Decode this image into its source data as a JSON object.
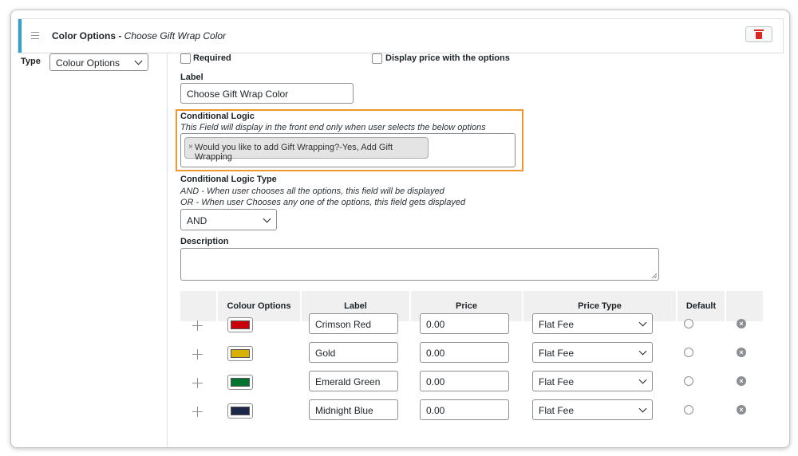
{
  "header": {
    "title": "Color Options -",
    "subtitle": "Choose Gift Wrap Color",
    "menu_icon": "hamburger-icon",
    "delete_icon": "trash-icon",
    "accent_color": "#2ea2cc",
    "delete_color": "#e0241b"
  },
  "type_field": {
    "label": "Type",
    "value": "Colour Options"
  },
  "required": {
    "label": "Required",
    "checked": false
  },
  "display_price": {
    "label": "Display price with the options",
    "checked": false
  },
  "label_field": {
    "label": "Label",
    "value": "Choose Gift Wrap Color"
  },
  "conditional_logic": {
    "label": "Conditional Logic",
    "help": "This Field will display in the front end only when user selects the below options",
    "tag_remove": "×",
    "tag": "Would you like to add Gift Wrapping?-Yes, Add Gift Wrapping",
    "highlight_color": "#f0962e"
  },
  "logic_type": {
    "label": "Conditional Logic Type",
    "help_and": "AND - When user chooses all the options, this field will be displayed",
    "help_or": "OR - When user Chooses any one of the options, this field gets displayed",
    "value": "AND"
  },
  "description": {
    "label": "Description",
    "value": ""
  },
  "table": {
    "headers": [
      "Colour Options",
      "Label",
      "Price",
      "Price Type",
      "Default"
    ],
    "rows": [
      {
        "color": "#c8000a",
        "label": "Crimson Red",
        "price": "0.00",
        "price_type": "Flat Fee"
      },
      {
        "color": "#d9b100",
        "label": "Gold",
        "price": "0.00",
        "price_type": "Flat Fee"
      },
      {
        "color": "#00732e",
        "label": "Emerald Green",
        "price": "0.00",
        "price_type": "Flat Fee"
      },
      {
        "color": "#1c2747",
        "label": "Midnight Blue",
        "price": "0.00",
        "price_type": "Flat Fee"
      }
    ]
  }
}
